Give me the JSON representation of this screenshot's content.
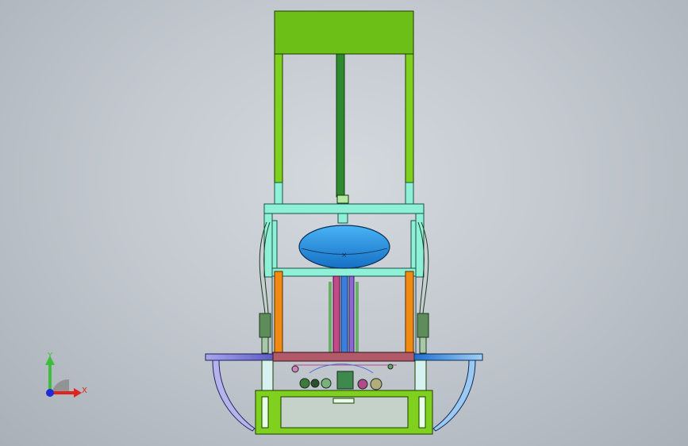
{
  "triad": {
    "y_label": "Y",
    "x_label": "X",
    "y_color": "#3dbf3d",
    "x_color": "#e0231c",
    "z_color": "#1f2bd6",
    "origin_color": "#8a8a8a"
  },
  "model_colors": {
    "top_block": "#6cbf16",
    "side_columns": "#7fd11e",
    "central_rod": "#2f8a2f",
    "frame": "#8ff0d8",
    "dome": "#1e8fe0",
    "side_posts": "#f08a12",
    "platform_left": "#7a7ad8",
    "platform_center": "#b05a6a",
    "platform_right": "#2a7fd6",
    "base_frame": "#7fd11e"
  },
  "icons": [
    "coordinate-triad-icon"
  ]
}
